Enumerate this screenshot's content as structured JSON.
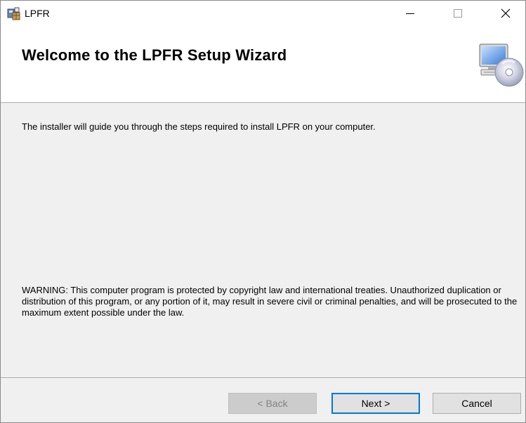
{
  "window": {
    "title": "LPFR",
    "controls": [
      "minimize-icon",
      "maximize-icon",
      "close-icon"
    ]
  },
  "banner": {
    "title": "Welcome to the LPFR Setup Wizard",
    "icon": "computer-disc-icon"
  },
  "body": {
    "intro": "The installer will guide you through the steps required to install LPFR on your computer.",
    "warning": "WARNING: This computer program is protected by copyright law and international treaties. Unauthorized duplication or distribution of this program, or any portion of it, may result in severe civil or criminal penalties, and will be prosecuted to the maximum extent possible under the law."
  },
  "buttons": {
    "back": "< Back",
    "next": "Next >",
    "cancel": "Cancel"
  },
  "colors": {
    "focus_border": "#0078d7",
    "dialog_bg": "#f0f0f0",
    "banner_bg": "#ffffff"
  }
}
